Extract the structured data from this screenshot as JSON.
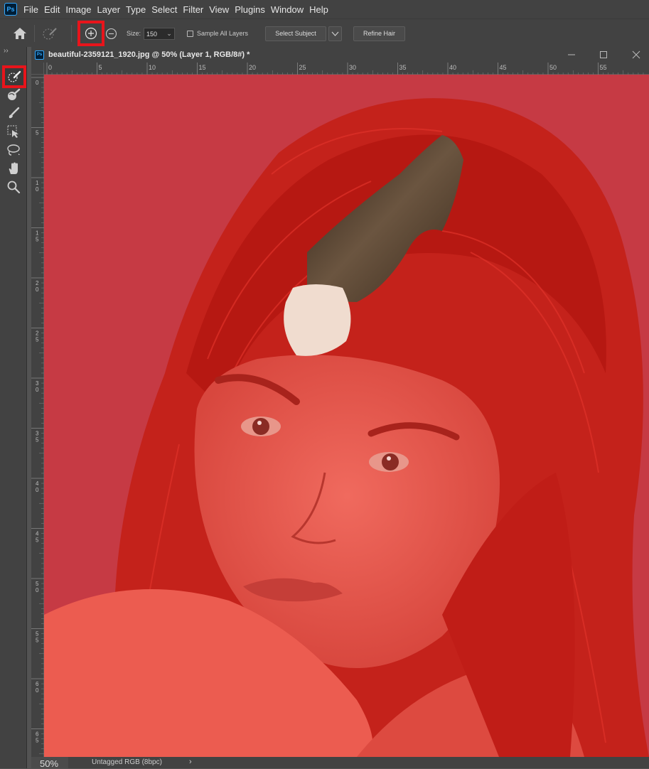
{
  "app": {
    "logo_text": "Ps"
  },
  "menu": [
    "File",
    "Edit",
    "Image",
    "Layer",
    "Type",
    "Select",
    "Filter",
    "View",
    "Plugins",
    "Window",
    "Help"
  ],
  "options": {
    "size_label": "Size:",
    "size_value": "150",
    "sample_all_layers_label": "Sample All Layers",
    "sample_all_layers_checked": false,
    "select_subject_label": "Select Subject",
    "refine_hair_label": "Refine Hair",
    "active_mode": "add-to-selection"
  },
  "tools": [
    "quick-selection-icon",
    "refine-edge-brush-icon",
    "brush-icon",
    "object-selection-icon",
    "lasso-icon",
    "hand-icon",
    "zoom-icon"
  ],
  "active_tool": "quick-selection-icon",
  "document": {
    "title": "beautiful-2359121_1920.jpg @ 50% (Layer 1, RGB/8#) *",
    "ruler_top_labels": [
      "0",
      "5",
      "10",
      "15",
      "20",
      "25",
      "30",
      "35",
      "40",
      "45",
      "50",
      "55"
    ],
    "ruler_left_labels": [
      "0",
      "5",
      "1 0",
      "1 5",
      "2 0",
      "2 5",
      "3 0",
      "3 5",
      "4 0",
      "4 5",
      "5 0",
      "5 5",
      "6 0",
      "6 5"
    ],
    "overlay_color": "#e02020"
  },
  "status": {
    "zoom": "50%",
    "profile": "Untagged RGB (8bpc)",
    "arrow": "›"
  },
  "highlight_color": "#e8141b"
}
